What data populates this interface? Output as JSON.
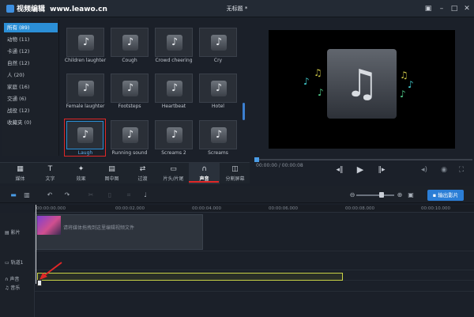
{
  "titlebar": {
    "app_name": "视频编辑",
    "site": "www.leawo.cn",
    "document_title": "无标题 *",
    "icons": [
      "save-icon",
      "minimize-icon",
      "maximize-icon",
      "close-icon"
    ]
  },
  "sidebar": {
    "categories": [
      {
        "label": "所有 (89)",
        "selected": true
      },
      {
        "label": "动物 (11)"
      },
      {
        "label": "卡通 (12)"
      },
      {
        "label": "自然 (12)"
      },
      {
        "label": "人 (20)"
      },
      {
        "label": "家庭 (16)"
      },
      {
        "label": "交通 (6)"
      },
      {
        "label": "战役 (12)"
      },
      {
        "label": "收藏夹 (0)"
      }
    ]
  },
  "sounds": [
    "Children laughter",
    "Cough",
    "Crowd cheering",
    "Cry",
    "Female laughter",
    "Footsteps",
    "Heartbeat",
    "Hotel",
    "Laugh",
    "Running sound",
    "Screams 2",
    "Screams"
  ],
  "selected_sound": "Laugh",
  "preview": {
    "time": "00:00:00 / 00:00:08",
    "controls": [
      "prev-icon",
      "play-icon",
      "next-icon",
      "volume-icon",
      "snapshot-icon",
      "fullscreen-icon"
    ]
  },
  "tabs": [
    {
      "label": "媒体",
      "icon": "media-icon"
    },
    {
      "label": "文字",
      "icon": "text-icon"
    },
    {
      "label": "效果",
      "icon": "effects-icon"
    },
    {
      "label": "图中图",
      "icon": "pip-icon"
    },
    {
      "label": "过渡",
      "icon": "transition-icon"
    },
    {
      "label": "片头/片尾",
      "icon": "intro-outro-icon"
    },
    {
      "label": "声音",
      "icon": "headphones-icon",
      "active": true
    },
    {
      "label": "分割屏幕",
      "icon": "split-screen-icon"
    }
  ],
  "timeline": {
    "export_label": "输出影片",
    "ruler": [
      "00:00:00.000",
      "00:00:02.000",
      "00:00:04.000",
      "00:00:06.000",
      "00:00:08.000",
      "00:00:10.000"
    ],
    "tracks": [
      {
        "label": "影片",
        "icon": "film-icon"
      },
      {
        "label": "轨道1",
        "icon": "layer-icon"
      },
      {
        "label": "声音",
        "icon": "headphones-icon"
      },
      {
        "label": "音乐",
        "icon": "music-icon"
      }
    ],
    "video_placeholder": "请将媒体拖拽到这里编辑视频文件"
  },
  "colors": {
    "accent": "#2b8fd6",
    "selection": "#e02727",
    "audio_clip": "#c9d246"
  }
}
